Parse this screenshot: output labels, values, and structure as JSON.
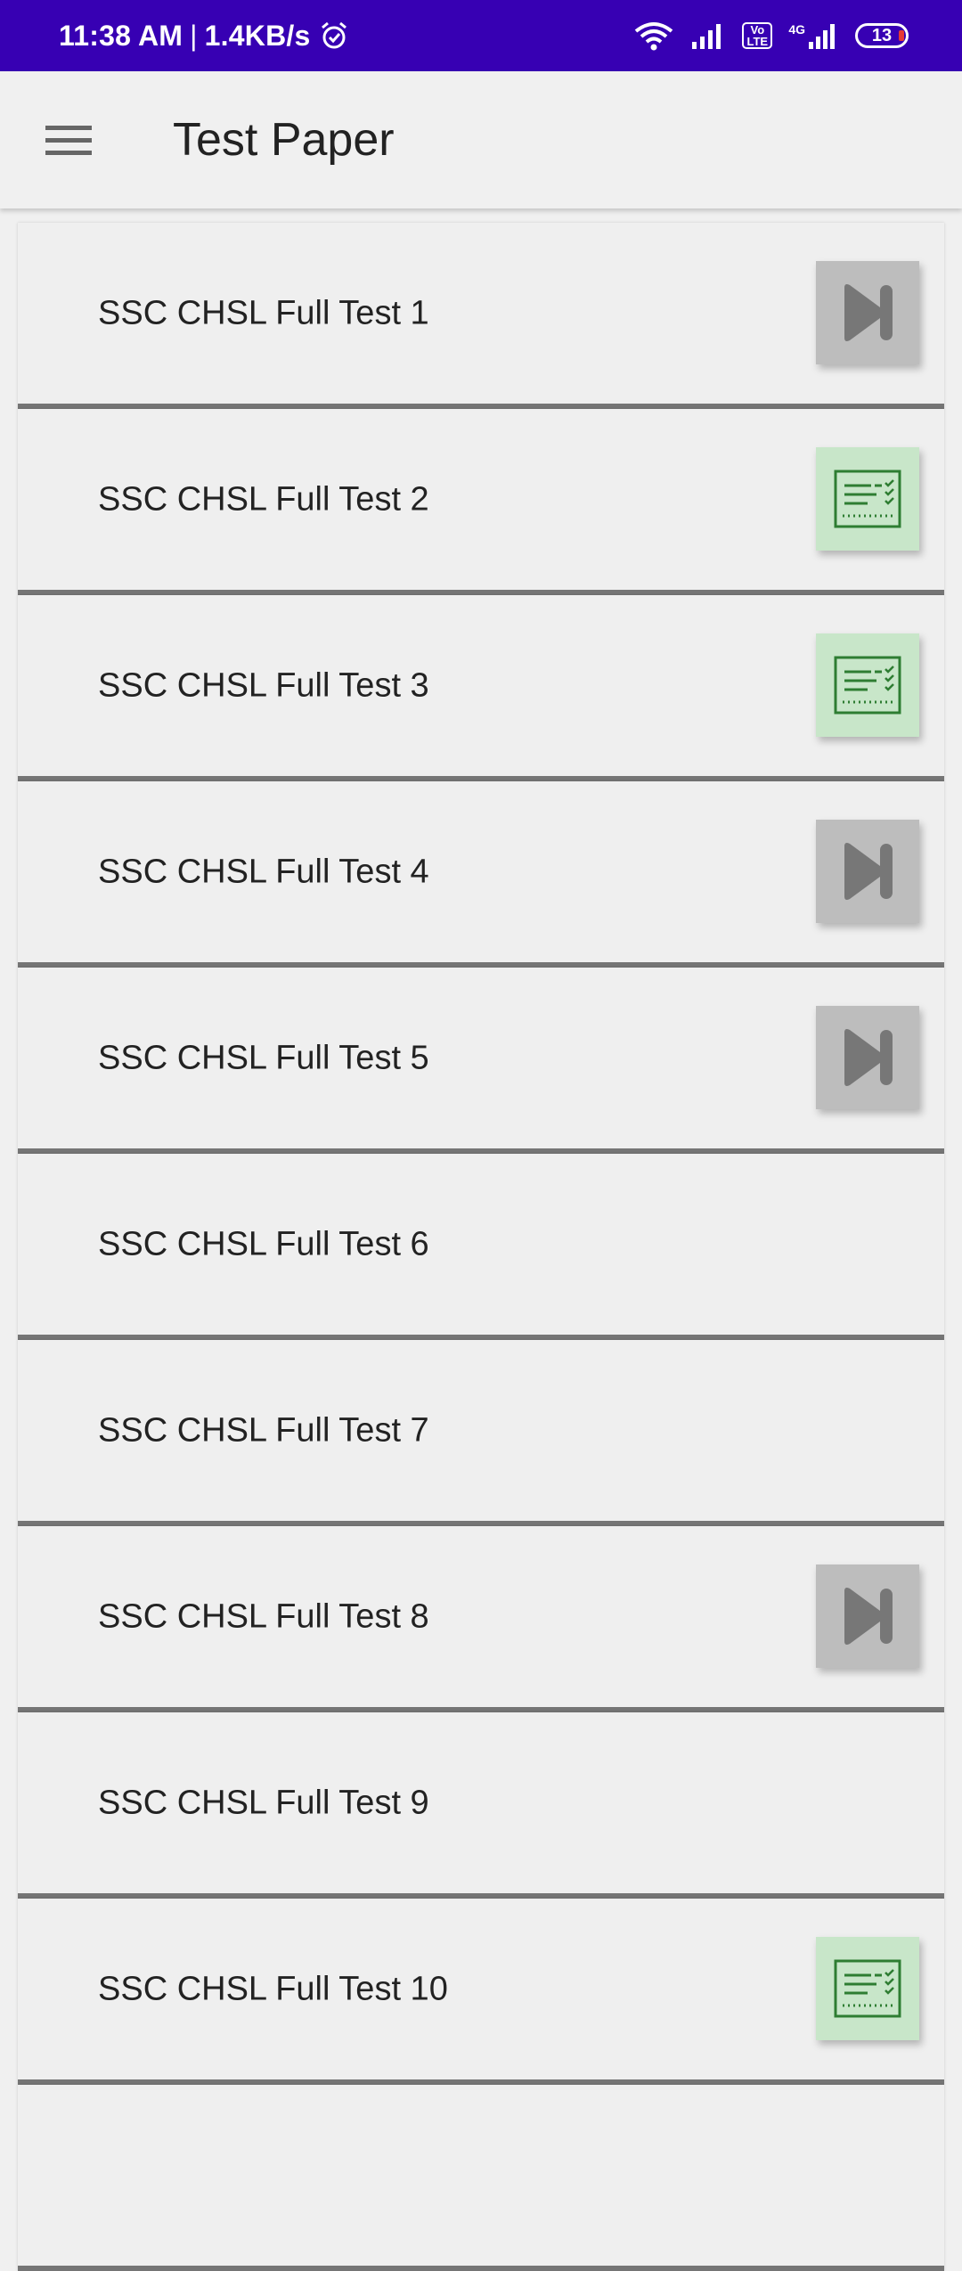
{
  "status_bar": {
    "time": "11:38 AM",
    "separator": "|",
    "speed": "1.4KB/s",
    "volte_top": "Vo",
    "volte_bottom": "LTE",
    "network": "4G",
    "battery": "13",
    "background_color": "#3700b3"
  },
  "app_bar": {
    "title": "Test Paper",
    "menu_icon": "menu-icon"
  },
  "list": {
    "items": [
      {
        "label": "SSC CHSL Full Test 1",
        "action": "skip-next-icon"
      },
      {
        "label": "SSC CHSL Full Test 2",
        "action": "result-sheet-icon"
      },
      {
        "label": "SSC CHSL Full Test 3",
        "action": "result-sheet-icon"
      },
      {
        "label": "SSC CHSL Full Test 4",
        "action": "skip-next-icon"
      },
      {
        "label": "SSC CHSL Full Test 5",
        "action": "skip-next-icon"
      },
      {
        "label": "SSC CHSL Full Test 6",
        "action": null
      },
      {
        "label": "SSC CHSL Full Test 7",
        "action": null
      },
      {
        "label": "SSC CHSL Full Test 8",
        "action": "skip-next-icon"
      },
      {
        "label": "SSC CHSL Full Test 9",
        "action": null
      },
      {
        "label": "SSC CHSL Full Test 10",
        "action": "result-sheet-icon"
      }
    ]
  },
  "colors": {
    "skip_button_bg": "#bdbdbd",
    "result_button_bg": "#c8e6c9",
    "divider": "#757575"
  }
}
